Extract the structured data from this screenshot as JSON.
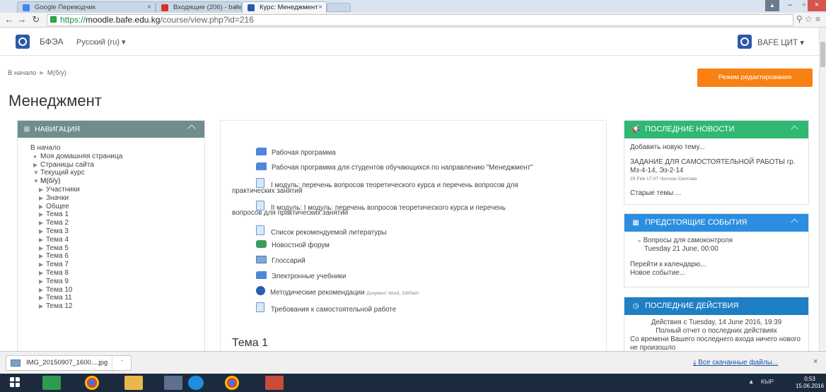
{
  "browser": {
    "tabs": [
      {
        "label": "Google Переводчик",
        "active": false
      },
      {
        "label": "Входящие (206) - bafen...",
        "active": false
      },
      {
        "label": "Курс: Менеджмент",
        "active": true
      }
    ],
    "url": {
      "scheme": "https://",
      "host": "moodle.bafe.edu.kg",
      "path": "/course/view.php?id=216"
    }
  },
  "header": {
    "brand": "БФЭА",
    "language": "Русский (ru) ▾",
    "user": "BAFE ЦИТ ▾"
  },
  "breadcrumb": {
    "home": "В начало",
    "current": "М(б/у)"
  },
  "edit_button": "Режим редактирования",
  "page_title": "Менеджмент",
  "navigation": {
    "title": "НАВИГАЦИЯ",
    "items": [
      {
        "label": "В начало",
        "marker": "",
        "indent": 0
      },
      {
        "label": "Моя домашняя страница",
        "marker": "●",
        "indent": 1
      },
      {
        "label": "Страницы сайта",
        "marker": "▶",
        "indent": 1
      },
      {
        "label": "Текущий курс",
        "marker": "▼",
        "indent": 1
      },
      {
        "label": "М(б/у)",
        "marker": "▼",
        "indent": 2
      },
      {
        "label": "Участники",
        "marker": "▶",
        "indent": 3
      },
      {
        "label": "Значки",
        "marker": "▶",
        "indent": 3
      },
      {
        "label": "Общее",
        "marker": "▶",
        "indent": 3
      },
      {
        "label": "Тема 1",
        "marker": "▶",
        "indent": 3
      },
      {
        "label": "Тема 2",
        "marker": "▶",
        "indent": 3
      },
      {
        "label": "Тема 3",
        "marker": "▶",
        "indent": 3
      },
      {
        "label": "Тема 4",
        "marker": "▶",
        "indent": 3
      },
      {
        "label": "Тема 5",
        "marker": "▶",
        "indent": 3
      },
      {
        "label": "Тема 6",
        "marker": "▶",
        "indent": 3
      },
      {
        "label": "Тема 7",
        "marker": "▶",
        "indent": 3
      },
      {
        "label": "Тема 8",
        "marker": "▶",
        "indent": 3
      },
      {
        "label": "Тема 9",
        "marker": "▶",
        "indent": 3
      },
      {
        "label": "Тема 10",
        "marker": "▶",
        "indent": 3
      },
      {
        "label": "Тема 11",
        "marker": "▶",
        "indent": 3
      },
      {
        "label": "Тема 12",
        "marker": "▶",
        "indent": 3
      }
    ]
  },
  "activities": [
    {
      "icon": "folder-icon",
      "label": "Рабочая программа"
    },
    {
      "icon": "folder-icon",
      "label": "Рабочая программа для студентов обучающихся по направлению \"Менеджмент\""
    },
    {
      "icon": "file-icon",
      "label": "I модуль: перечень вопросов теоретического курса и перечень вопросов для",
      "label2": "практических занятий"
    },
    {
      "icon": "file-icon",
      "label": "II модуль: I модуль: перечень вопросов теоретического курса и перечень",
      "label2": "вопросов для практических занятий"
    },
    {
      "icon": "file-icon",
      "label": "Список рекомендуемой литературы"
    },
    {
      "icon": "forum-icon",
      "label": "Новостной форум"
    },
    {
      "icon": "glossary-icon",
      "label": "Глоссарий"
    },
    {
      "icon": "folder-icon",
      "label": "Электронные учебники"
    },
    {
      "icon": "word-icon",
      "label": "Методические рекомендации",
      "note": "Документ Word, 33Кбайт"
    },
    {
      "icon": "file-icon",
      "label": "Требования к самостоятельной работе"
    }
  ],
  "section_title": "Тема 1",
  "news": {
    "title": "ПОСЛЕДНИЕ НОВОСТИ",
    "add": "Добавить новую тему...",
    "headline": "ЗАДАНИЕ ДЛЯ САМОСТОЯТЕЛЬНОЙ РАБОТЫ гр. Мз-4-14, Эз-2-14",
    "meta": "25 Feb 17:07 Чоллон Сеитова",
    "older": "Старые темы ..."
  },
  "events": {
    "title": "ПРЕДСТОЯЩИЕ СОБЫТИЯ",
    "item": "Вопросы для самоконтроля",
    "date": "Tuesday 21 June, 00:00",
    "calendar": "Перейти к календарю...",
    "new_event": "Новое событие..."
  },
  "recent": {
    "title": "ПОСЛЕДНИЕ ДЕЙСТВИЯ",
    "since": "Действия с Tuesday, 14 June 2016, 19:39",
    "report": "Полный отчет о последних действиях",
    "none": "Со времени Вашего последнего входа ничего нового не произошло"
  },
  "downloads": {
    "file": "IMG_20150907_1600....jpg",
    "all": "Все скачанные файлы..."
  },
  "taskbar": {
    "lang": "КЫР",
    "time": "0:53",
    "date": "15.06.2016"
  },
  "colors": {
    "accent_orange": "#f98012",
    "nav_header": "#6f8d8d",
    "news_header": "#2fb872",
    "events_header": "#2c8ee0",
    "recent_header": "#1f7fc4"
  }
}
